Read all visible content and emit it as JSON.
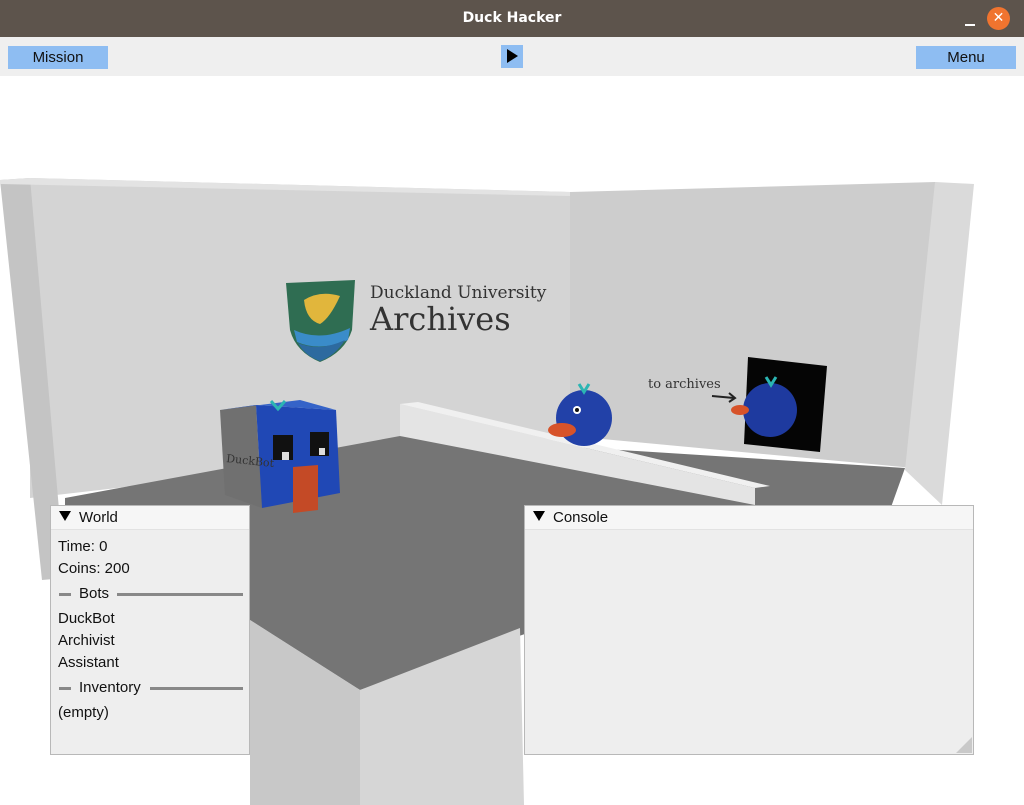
{
  "window": {
    "title": "Duck Hacker",
    "minimize_glyph": "_",
    "close_glyph": "✕"
  },
  "toolbar": {
    "mission_label": "Mission",
    "menu_label": "Menu",
    "play_icon": "play-icon"
  },
  "scene": {
    "logo_line1": "Duckland University",
    "logo_line2": "Archives",
    "sign_text": "to archives",
    "bot_label": "DuckBot"
  },
  "world_panel": {
    "title": "World",
    "time": "Time: 0",
    "coins": "Coins: 200",
    "bots_header": "Bots",
    "bots": [
      "DuckBot",
      "Archivist",
      "Assistant"
    ],
    "inventory_header": "Inventory",
    "inventory": [
      "(empty)"
    ]
  },
  "console_panel": {
    "title": "Console"
  },
  "colors": {
    "titlebar": "#5d544c",
    "close": "#f0742f",
    "button": "#8ebdf2",
    "floor": "#757575",
    "wall": "#d3d3d3",
    "duck_blue": "#2241a8"
  }
}
